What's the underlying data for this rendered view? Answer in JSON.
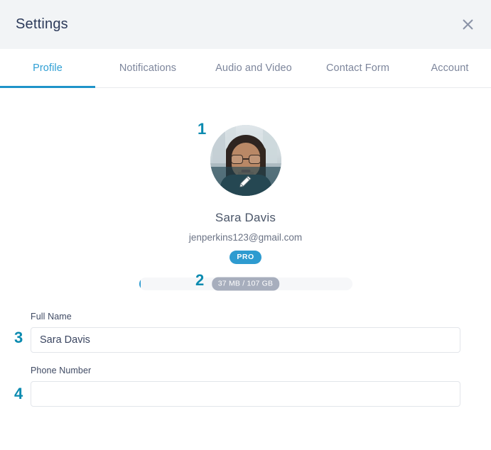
{
  "window": {
    "title": "Settings",
    "close_icon": "close-icon"
  },
  "tabs": [
    {
      "label": "Profile",
      "active": true
    },
    {
      "label": "Notifications",
      "active": false
    },
    {
      "label": "Audio and Video",
      "active": false
    },
    {
      "label": "Contact Form",
      "active": false
    },
    {
      "label": "Account",
      "active": false
    }
  ],
  "profile": {
    "avatar_icon": "edit-pencil-icon",
    "avatar_alt": "user-avatar-photo",
    "name": "Sara Davis",
    "email": "jenperkins123@gmail.com",
    "badge": "PRO"
  },
  "storage": {
    "label": "37 MB / 107 GB",
    "used": "37 MB",
    "total": "107 GB",
    "percent": 0.03
  },
  "form": {
    "full_name": {
      "label": "Full Name",
      "value": "Sara Davis",
      "placeholder": ""
    },
    "phone_number": {
      "label": "Phone Number",
      "value": "",
      "placeholder": ""
    }
  },
  "markers": {
    "one": "1",
    "two": "2",
    "three": "3",
    "four": "4"
  },
  "colors": {
    "accent_blue": "#2e9bd0",
    "tab_active": "#2f9fd4",
    "marker_teal": "#0c8bb0",
    "header_bg": "#f2f4f6",
    "text_dark": "#2c3a5a",
    "text_muted": "#7d869c",
    "pill_gray": "#a7aebd"
  }
}
